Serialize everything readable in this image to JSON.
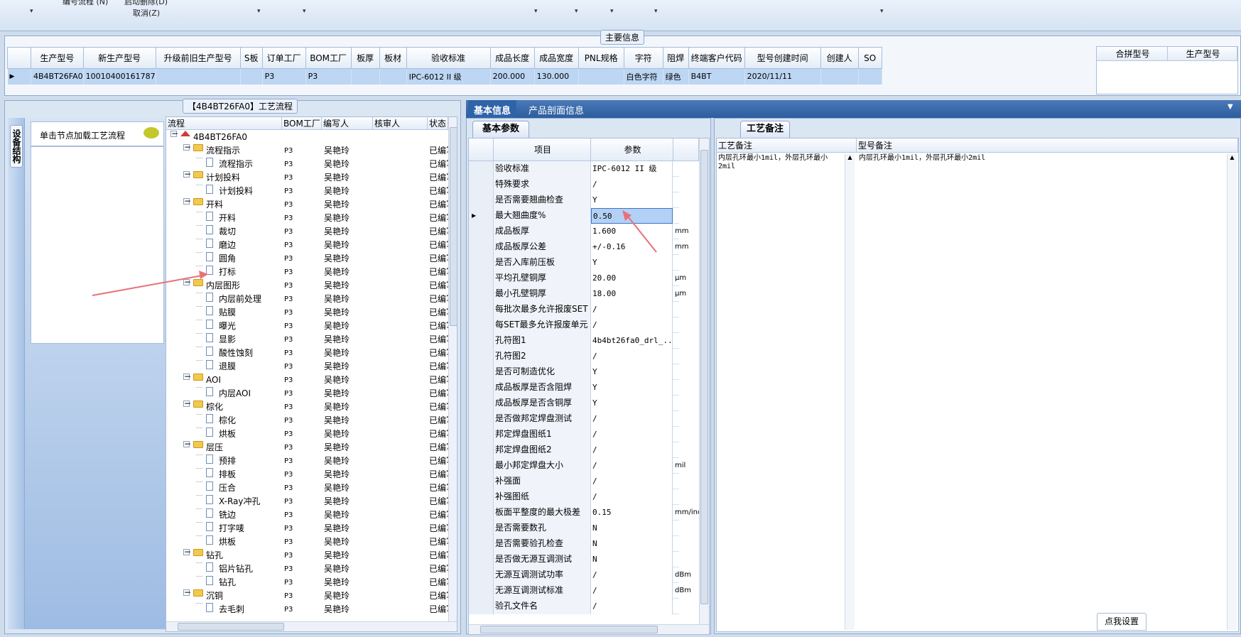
{
  "toolbar": {
    "item1": "编号流程 (N)",
    "item2": "启动删除(D)",
    "item3": "取消(Z)"
  },
  "main_info": {
    "title": "主要信息",
    "columns": [
      "生产型号",
      "新生产型号",
      "升级前旧生产型号",
      "S板",
      "订单工厂",
      "BOM工厂",
      "板厚",
      "板材",
      "验收标准",
      "成品长度",
      "成品宽度",
      "PNL规格",
      "字符",
      "阻焊",
      "终端客户代码",
      "型号创建时间",
      "创建人",
      "SO"
    ],
    "row": [
      "4B4BT26FA0",
      "10010400161787",
      "",
      "",
      "P3",
      "P3",
      "",
      "",
      "IPC-6012 II 级",
      "200.000",
      "130.000",
      "",
      "白色字符",
      "绿色",
      "B4BT",
      "2020/11/11",
      "",
      ""
    ],
    "right_columns": [
      "合拼型号",
      "生产型号"
    ]
  },
  "flow_panel": {
    "title": "【4B4BT26FA0】工艺流程",
    "side_tab": "设备结构",
    "hint_button": "单击节点加载工艺流程",
    "columns": [
      "流程",
      "BOM工厂",
      "编写人",
      "核审人",
      "状态"
    ],
    "tree": [
      {
        "level": 0,
        "type": "root",
        "label": "4B4BT26FA0",
        "bom": "",
        "writer": "",
        "status": ""
      },
      {
        "level": 1,
        "type": "folder",
        "label": "流程指示",
        "bom": "P3",
        "writer": "吴艳玲",
        "status": "已编写"
      },
      {
        "level": 2,
        "type": "doc",
        "label": "流程指示",
        "bom": "P3",
        "writer": "吴艳玲",
        "status": "已编写"
      },
      {
        "level": 1,
        "type": "folder",
        "label": "计划投料",
        "bom": "P3",
        "writer": "吴艳玲",
        "status": "已编写"
      },
      {
        "level": 2,
        "type": "doc",
        "label": "计划投料",
        "bom": "P3",
        "writer": "吴艳玲",
        "status": "已编写"
      },
      {
        "level": 1,
        "type": "folder",
        "label": "开料",
        "bom": "P3",
        "writer": "吴艳玲",
        "status": "已编写"
      },
      {
        "level": 2,
        "type": "doc",
        "label": "开料",
        "bom": "P3",
        "writer": "吴艳玲",
        "status": "已编写"
      },
      {
        "level": 2,
        "type": "doc",
        "label": "裁切",
        "bom": "P3",
        "writer": "吴艳玲",
        "status": "已编写"
      },
      {
        "level": 2,
        "type": "doc",
        "label": "磨边",
        "bom": "P3",
        "writer": "吴艳玲",
        "status": "已编写"
      },
      {
        "level": 2,
        "type": "doc",
        "label": "圆角",
        "bom": "P3",
        "writer": "吴艳玲",
        "status": "已编写"
      },
      {
        "level": 2,
        "type": "doc",
        "label": "打标",
        "bom": "P3",
        "writer": "吴艳玲",
        "status": "已编写"
      },
      {
        "level": 1,
        "type": "folder",
        "label": "内层图形",
        "bom": "P3",
        "writer": "吴艳玲",
        "status": "已编写"
      },
      {
        "level": 2,
        "type": "doc",
        "label": "内层前处理",
        "bom": "P3",
        "writer": "吴艳玲",
        "status": "已编写"
      },
      {
        "level": 2,
        "type": "doc",
        "label": "贴膜",
        "bom": "P3",
        "writer": "吴艳玲",
        "status": "已编写"
      },
      {
        "level": 2,
        "type": "doc",
        "label": "曝光",
        "bom": "P3",
        "writer": "吴艳玲",
        "status": "已编写"
      },
      {
        "level": 2,
        "type": "doc",
        "label": "显影",
        "bom": "P3",
        "writer": "吴艳玲",
        "status": "已编写"
      },
      {
        "level": 2,
        "type": "doc",
        "label": "酸性蚀刻",
        "bom": "P3",
        "writer": "吴艳玲",
        "status": "已编写"
      },
      {
        "level": 2,
        "type": "doc",
        "label": "退膜",
        "bom": "P3",
        "writer": "吴艳玲",
        "status": "已编写"
      },
      {
        "level": 1,
        "type": "folder",
        "label": "AOI",
        "bom": "P3",
        "writer": "吴艳玲",
        "status": "已编写"
      },
      {
        "level": 2,
        "type": "doc",
        "label": "内层AOI",
        "bom": "P3",
        "writer": "吴艳玲",
        "status": "已编写"
      },
      {
        "level": 1,
        "type": "folder",
        "label": "棕化",
        "bom": "P3",
        "writer": "吴艳玲",
        "status": "已编写"
      },
      {
        "level": 2,
        "type": "doc",
        "label": "棕化",
        "bom": "P3",
        "writer": "吴艳玲",
        "status": "已编写"
      },
      {
        "level": 2,
        "type": "doc",
        "label": "烘板",
        "bom": "P3",
        "writer": "吴艳玲",
        "status": "已编写"
      },
      {
        "level": 1,
        "type": "folder",
        "label": "层压",
        "bom": "P3",
        "writer": "吴艳玲",
        "status": "已编写"
      },
      {
        "level": 2,
        "type": "doc",
        "label": "预排",
        "bom": "P3",
        "writer": "吴艳玲",
        "status": "已编写"
      },
      {
        "level": 2,
        "type": "doc",
        "label": "排板",
        "bom": "P3",
        "writer": "吴艳玲",
        "status": "已编写"
      },
      {
        "level": 2,
        "type": "doc",
        "label": "压合",
        "bom": "P3",
        "writer": "吴艳玲",
        "status": "已编写"
      },
      {
        "level": 2,
        "type": "doc",
        "label": "X-Ray冲孔",
        "bom": "P3",
        "writer": "吴艳玲",
        "status": "已编写"
      },
      {
        "level": 2,
        "type": "doc",
        "label": "铣边",
        "bom": "P3",
        "writer": "吴艳玲",
        "status": "已编写"
      },
      {
        "level": 2,
        "type": "doc",
        "label": "打字唛",
        "bom": "P3",
        "writer": "吴艳玲",
        "status": "已编写"
      },
      {
        "level": 2,
        "type": "doc",
        "label": "烘板",
        "bom": "P3",
        "writer": "吴艳玲",
        "status": "已编写"
      },
      {
        "level": 1,
        "type": "folder",
        "label": "钻孔",
        "bom": "P3",
        "writer": "吴艳玲",
        "status": "已编写"
      },
      {
        "level": 2,
        "type": "doc",
        "label": "铝片钻孔",
        "bom": "P3",
        "writer": "吴艳玲",
        "status": "已编写"
      },
      {
        "level": 2,
        "type": "doc",
        "label": "钻孔",
        "bom": "P3",
        "writer": "吴艳玲",
        "status": "已编写"
      },
      {
        "level": 1,
        "type": "folder",
        "label": "沉铜",
        "bom": "P3",
        "writer": "吴艳玲",
        "status": "已编写"
      },
      {
        "level": 2,
        "type": "doc",
        "label": "去毛刺",
        "bom": "P3",
        "writer": "吴艳玲",
        "status": "已编写"
      }
    ]
  },
  "basic_panel": {
    "tabs": [
      "基本信息",
      "产品剖面信息"
    ],
    "subtab": "基本参数",
    "columns": [
      "项目",
      "参数"
    ],
    "rows": [
      [
        "验收标准",
        "IPC-6012 II 级",
        ""
      ],
      [
        "特殊要求",
        "/",
        ""
      ],
      [
        "是否需要翘曲检查",
        "Y",
        ""
      ],
      [
        "最大翘曲度%",
        "0.50",
        ""
      ],
      [
        "成品板厚",
        "1.600",
        "mm"
      ],
      [
        "成品板厚公差",
        "+/-0.16",
        "mm"
      ],
      [
        "是否入库前压板",
        "Y",
        ""
      ],
      [
        "平均孔壁铜厚",
        "20.00",
        "μm"
      ],
      [
        "最小孔壁铜厚",
        "18.00",
        "μm"
      ],
      [
        "每批次最多允许报废SET",
        "/",
        ""
      ],
      [
        "每SET最多允许报废单元",
        "/",
        ""
      ],
      [
        "孔符图1",
        "4b4bt26fa0_drl_...",
        ""
      ],
      [
        "孔符图2",
        "/",
        ""
      ],
      [
        "是否可制造优化",
        "Y",
        ""
      ],
      [
        "成品板厚是否含阻焊",
        "Y",
        ""
      ],
      [
        "成品板厚是否含铜厚",
        "Y",
        ""
      ],
      [
        "是否做邦定焊盘测试",
        "/",
        ""
      ],
      [
        "邦定焊盘图纸1",
        "/",
        ""
      ],
      [
        "邦定焊盘图纸2",
        "/",
        ""
      ],
      [
        "最小邦定焊盘大小",
        "/",
        "mil"
      ],
      [
        "补强面",
        "/",
        ""
      ],
      [
        "补强图纸",
        "/",
        ""
      ],
      [
        "板面平整度的最大极差",
        "0.15",
        "mm/inch"
      ],
      [
        "是否需要数孔",
        "N",
        ""
      ],
      [
        "是否需要验孔检查",
        "N",
        ""
      ],
      [
        "是否做无源互调测试",
        "N",
        ""
      ],
      [
        "无源互调测试功率",
        "/",
        "dBm"
      ],
      [
        "无源互调测试标准",
        "/",
        "dBm"
      ],
      [
        "验孔文件名",
        "/",
        ""
      ]
    ]
  },
  "remark_panel": {
    "tab": "工艺备注",
    "col1": "工艺备注",
    "col2": "型号备注",
    "text1": "内层孔环最小1mil，外层孔环最小2mil",
    "text2": "内层孔环最小1mil，外层孔环最小2mil",
    "settings_button": "点我设置"
  },
  "colors": {
    "selection": "#b3d1f5",
    "annotation_arrow": "#e8707a",
    "panel_border": "#8eaacf"
  }
}
